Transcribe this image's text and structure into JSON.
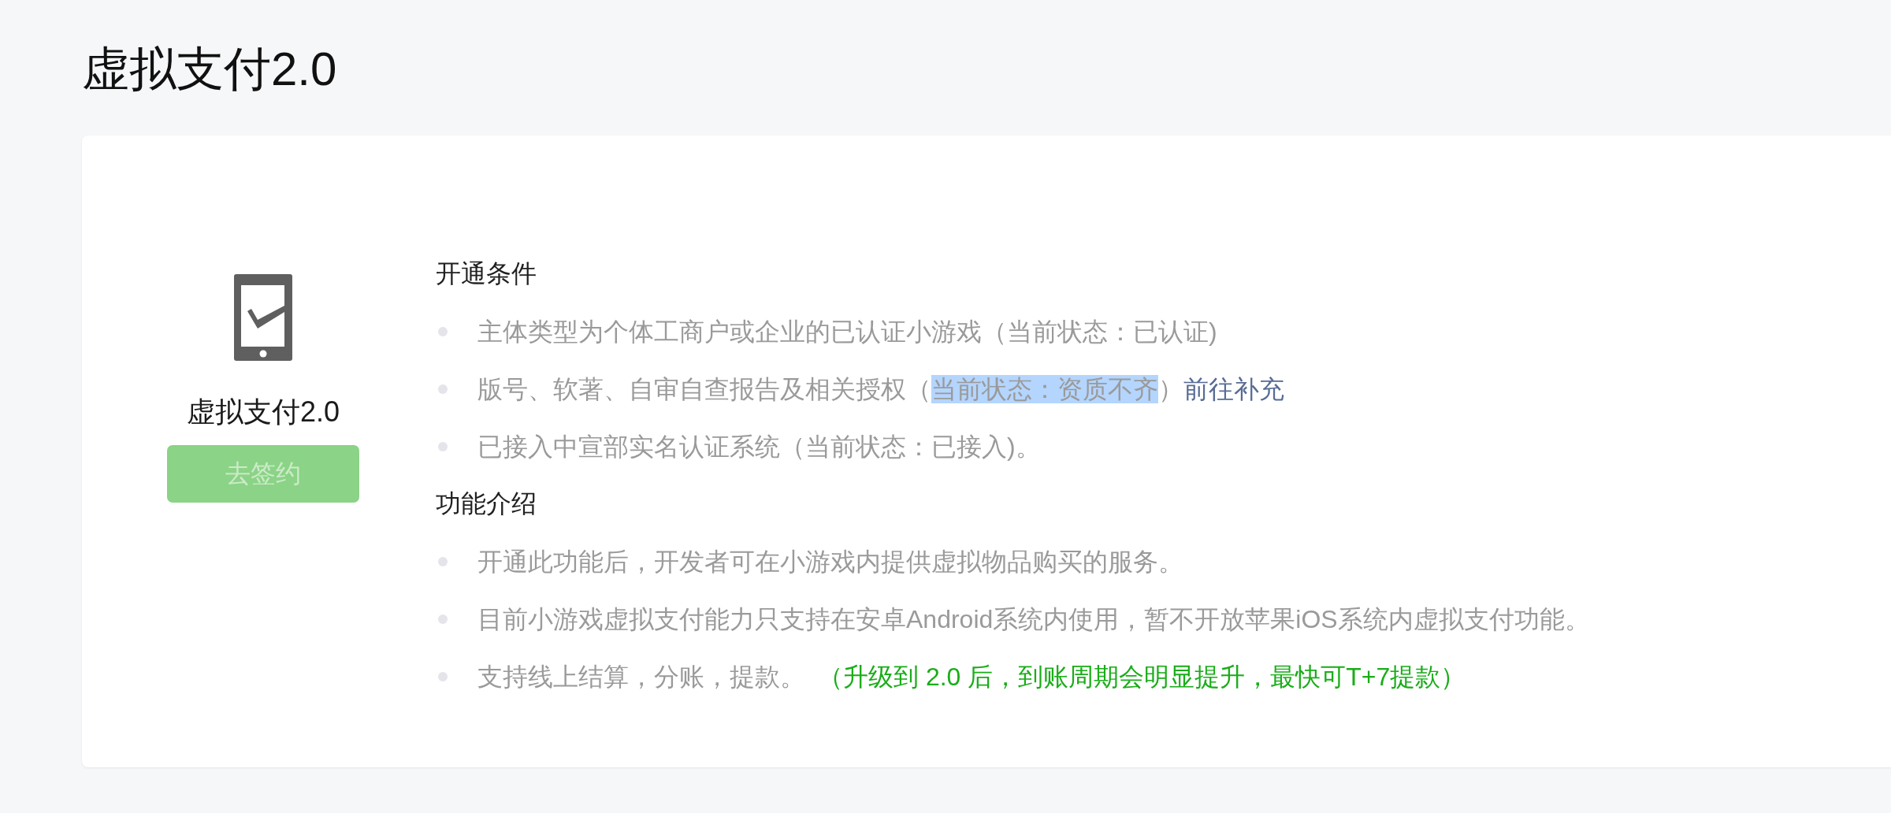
{
  "page": {
    "title": "虚拟支付2.0"
  },
  "product": {
    "name": "虚拟支付2.0",
    "button": {
      "label": "去签约",
      "disabled": true
    }
  },
  "sections": [
    {
      "heading": "开通条件",
      "items": [
        {
          "segments": [
            {
              "kind": "plain",
              "text": "主体类型为个体工商户或企业的已认证小游戏（当前状态：已认证)"
            }
          ]
        },
        {
          "segments": [
            {
              "kind": "plain",
              "text": "版号、软著、自审自查报告及相关授权（"
            },
            {
              "kind": "highlighted",
              "text": "当前状态：资质不齐"
            },
            {
              "kind": "plain",
              "text": "）"
            },
            {
              "kind": "link",
              "text": "前往补充"
            }
          ]
        },
        {
          "segments": [
            {
              "kind": "plain",
              "text": "已接入中宣部实名认证系统（当前状态：已接入)。"
            }
          ]
        }
      ]
    },
    {
      "heading": "功能介绍",
      "items": [
        {
          "segments": [
            {
              "kind": "plain",
              "text": "开通此功能后，开发者可在小游戏内提供虚拟物品购买的服务。"
            }
          ]
        },
        {
          "segments": [
            {
              "kind": "plain",
              "text": "目前小游戏虚拟支付能力只支持在安卓Android系统内使用，暂不开放苹果iOS系统内虚拟支付功能。"
            }
          ]
        },
        {
          "segments": [
            {
              "kind": "plain",
              "text": "支持线上结算，分账，提款。"
            },
            {
              "kind": "note",
              "text": "（升级到 2.0 后，到账周期会明显提升，最快可T+7提款）"
            }
          ]
        }
      ]
    }
  ]
}
